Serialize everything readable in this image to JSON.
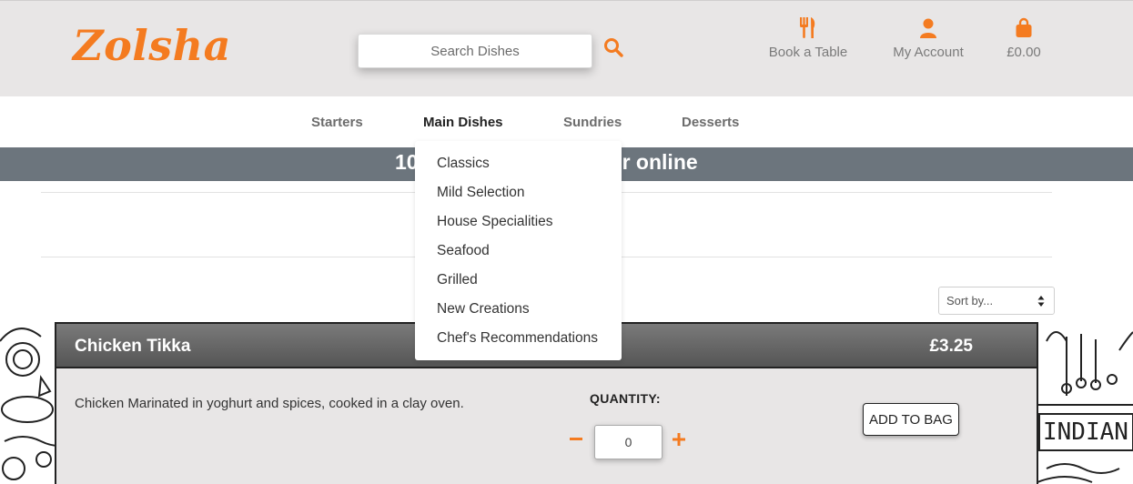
{
  "brand": {
    "logo_text": "Zolsha",
    "accent": "#f47b20"
  },
  "search": {
    "placeholder": "Search Dishes",
    "icon": "search-icon"
  },
  "header_links": {
    "book_table": {
      "label": "Book a Table",
      "icon": "cutlery-icon"
    },
    "account": {
      "label": "My Account",
      "icon": "user-icon"
    },
    "bag": {
      "label": "£0.00",
      "icon": "shopping-bag-icon"
    }
  },
  "nav": {
    "starters": "Starters",
    "main_dishes": "Main Dishes",
    "sundries": "Sundries",
    "desserts": "Desserts",
    "active": "Main Dishes"
  },
  "dropdown": {
    "items": [
      "Classics",
      "Mild Selection",
      "House Specialities",
      "Seafood",
      "Grilled",
      "New Creations",
      "Chef's Recommendations"
    ]
  },
  "banner": {
    "text": "10",
    "text_tail": "r online",
    "bg": "#6c757d"
  },
  "sort": {
    "selected": "Sort by..."
  },
  "product": {
    "name": "Chicken Tikka",
    "price": "£3.25",
    "description": "Chicken Marinated in yoghurt and spices, cooked in a clay oven.",
    "quantity_label": "QUANTITY:",
    "quantity_value": "0",
    "add_button": "ADD TO BAG"
  },
  "decor": {
    "doodle_text": "INDIAN F"
  }
}
